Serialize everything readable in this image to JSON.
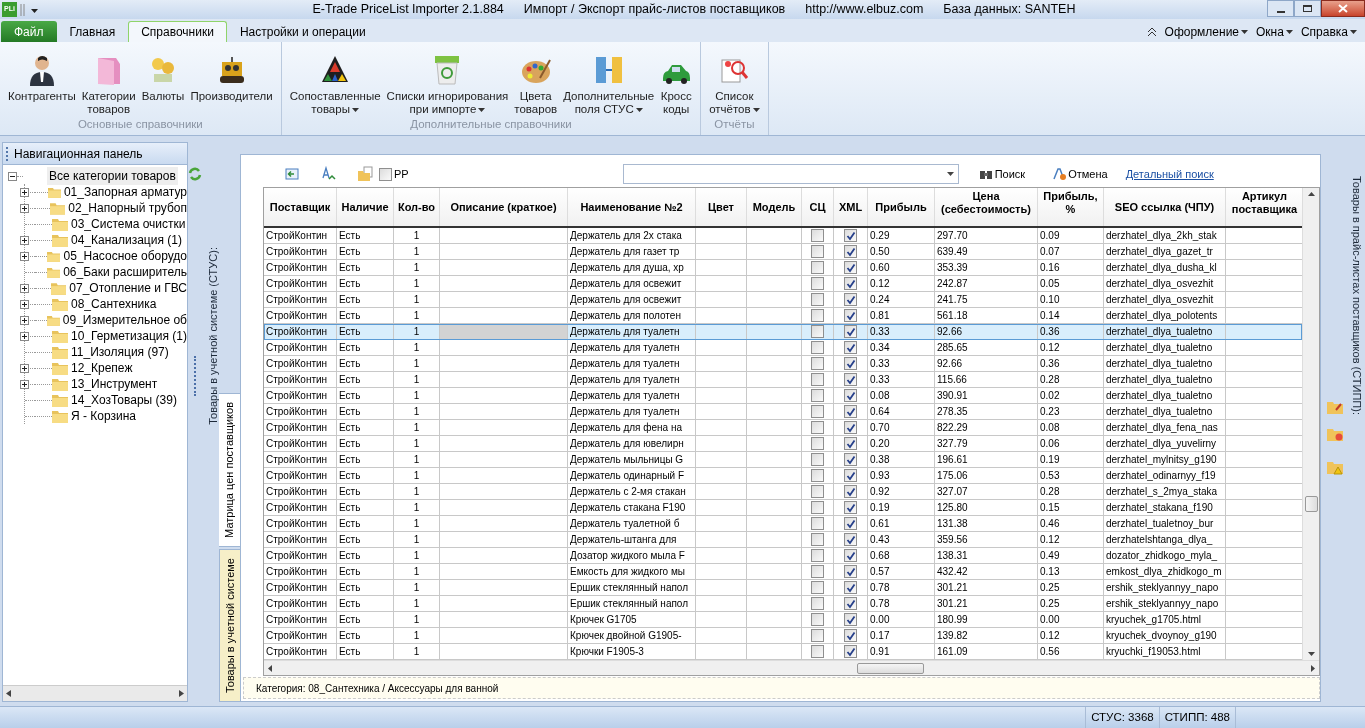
{
  "title_bar": {
    "logo": "PLi",
    "app": "E-Trade PriceList Importer 2.1.884",
    "subtitle": "Импорт / Экспорт прайс-листов поставщиков",
    "url": "http://www.elbuz.com",
    "database": "База данных: SANTEH"
  },
  "menu_tabs": [
    {
      "label": "Файл",
      "kind": "file",
      "selected": false
    },
    {
      "label": "Главная",
      "kind": "tab",
      "selected": false
    },
    {
      "label": "Справочники",
      "kind": "tab",
      "selected": true
    },
    {
      "label": "Настройки и операции",
      "kind": "tab",
      "selected": false
    }
  ],
  "menu_right": [
    "Оформление",
    "Окна",
    "Справка"
  ],
  "ribbon": {
    "groups": [
      {
        "title": "Основные справочники",
        "items": [
          {
            "lines": [
              "Контрагенты"
            ],
            "dropdown": false
          },
          {
            "lines": [
              "Категории",
              "товаров"
            ],
            "dropdown": false
          },
          {
            "lines": [
              "Валюты"
            ],
            "dropdown": false
          },
          {
            "lines": [
              "Производители"
            ],
            "dropdown": false
          }
        ]
      },
      {
        "title": "Дополнительные справочники",
        "items": [
          {
            "lines": [
              "Сопоставленные",
              "товары"
            ],
            "dropdown": true
          },
          {
            "lines": [
              "Списки игнорирования",
              "при импорте"
            ],
            "dropdown": true
          },
          {
            "lines": [
              "Цвета",
              "товаров"
            ],
            "dropdown": false
          },
          {
            "lines": [
              "Дополнительные",
              "поля СТУС"
            ],
            "dropdown": true
          },
          {
            "lines": [
              "Кросс",
              "коды"
            ],
            "dropdown": false
          }
        ]
      },
      {
        "title": "Отчёты",
        "items": [
          {
            "lines": [
              "Список",
              "отчётов"
            ],
            "dropdown": true
          }
        ]
      }
    ]
  },
  "nav_panel": {
    "title": "Навигационная панель",
    "tree": {
      "label": "Все категории товаров",
      "expanded": true,
      "children": [
        {
          "label": "01_Запорная арматур",
          "kind": "branch"
        },
        {
          "label": "02_Напорный трубоп",
          "kind": "branch"
        },
        {
          "label": "03_Система очистки",
          "kind": "leaf"
        },
        {
          "label": "04_Канализация (1)",
          "kind": "branch"
        },
        {
          "label": "05_Насосное оборудо",
          "kind": "branch"
        },
        {
          "label": "06_Баки расширитель",
          "kind": "leaf"
        },
        {
          "label": "07_Отопление и ГВС",
          "kind": "branch"
        },
        {
          "label": "08_Сантехника",
          "kind": "branch"
        },
        {
          "label": "09_Измерительное об",
          "kind": "branch"
        },
        {
          "label": "10_Герметизация (1)",
          "kind": "branch"
        },
        {
          "label": "11_Изоляция (97)",
          "kind": "leaf"
        },
        {
          "label": "12_Крепеж",
          "kind": "branch"
        },
        {
          "label": "13_Инструмент",
          "kind": "branch"
        },
        {
          "label": "14_ХозТовары (39)",
          "kind": "leaf"
        },
        {
          "label": "Я - Корзина",
          "kind": "leaf"
        }
      ]
    }
  },
  "side_label": "Товары в учетной системе (СТУС):",
  "side_tabs": [
    {
      "label": "Матрица цен поставщиков",
      "selected": true
    },
    {
      "label": "Товары в учетной системе",
      "selected": false
    }
  ],
  "toolbar": {
    "pp_checkbox": {
      "label": "PP",
      "checked": false
    },
    "search_button": "Поиск",
    "cancel_button": "Отмена",
    "detail_link": "Детальный поиск"
  },
  "table": {
    "columns": [
      {
        "label": "Поставщик",
        "kind": "text"
      },
      {
        "label": "Наличие",
        "kind": "text"
      },
      {
        "label": "Кол-во",
        "kind": "center"
      },
      {
        "label": "Описание (краткое)",
        "kind": "text"
      },
      {
        "label": "Наименование №2",
        "kind": "text"
      },
      {
        "label": "Цвет",
        "kind": "text"
      },
      {
        "label": "Модель",
        "kind": "text"
      },
      {
        "label": "СЦ",
        "kind": "check"
      },
      {
        "label": "XML",
        "kind": "check"
      },
      {
        "label": "Прибыль",
        "kind": "text"
      },
      {
        "label": "Цена\n(себестоимость)",
        "kind": "text"
      },
      {
        "label": "Прибыль,\n%",
        "kind": "text"
      },
      {
        "label": "SEO ссылка (ЧПУ)",
        "kind": "text"
      },
      {
        "label": "Артикул\nпоставщика",
        "kind": "text"
      }
    ],
    "rows": [
      {
        "selected": false,
        "cells": [
          "СтройКонтин",
          "Есть",
          "1",
          null,
          "Держатель для 2х стака",
          null,
          null,
          false,
          true,
          "0.29",
          "297.70",
          "0.09",
          "derzhatel_dlya_2kh_stak",
          null
        ]
      },
      {
        "selected": false,
        "cells": [
          "СтройКонтин",
          "Есть",
          "1",
          null,
          "Держатель для газет тр",
          null,
          null,
          false,
          true,
          "0.50",
          "639.49",
          "0.07",
          "derzhatel_dlya_gazet_tr",
          null
        ]
      },
      {
        "selected": false,
        "cells": [
          "СтройКонтин",
          "Есть",
          "1",
          null,
          "Держатель для душа, хр",
          null,
          null,
          false,
          true,
          "0.60",
          "353.39",
          "0.16",
          "derzhatel_dlya_dusha_kl",
          null
        ]
      },
      {
        "selected": false,
        "cells": [
          "СтройКонтин",
          "Есть",
          "1",
          null,
          "Держатель для освежит",
          null,
          null,
          false,
          true,
          "0.12",
          "242.87",
          "0.05",
          "derzhatel_dlya_osvezhit",
          null
        ]
      },
      {
        "selected": false,
        "cells": [
          "СтройКонтин",
          "Есть",
          "1",
          null,
          "Держатель для освежит",
          null,
          null,
          false,
          true,
          "0.24",
          "241.75",
          "0.10",
          "derzhatel_dlya_osvezhit",
          null
        ]
      },
      {
        "selected": false,
        "cells": [
          "СтройКонтин",
          "Есть",
          "1",
          null,
          "Держатель для полотен",
          null,
          null,
          false,
          true,
          "0.81",
          "561.18",
          "0.14",
          "derzhatel_dlya_polotents",
          null
        ]
      },
      {
        "selected": true,
        "cells": [
          "СтройКонтин",
          "Есть",
          "1",
          null,
          "Держатель для туалетн",
          null,
          null,
          false,
          true,
          "0.33",
          "92.66",
          "0.36",
          "derzhatel_dlya_tualetno",
          null
        ]
      },
      {
        "selected": false,
        "cells": [
          "СтройКонтин",
          "Есть",
          "1",
          null,
          "Держатель для туалетн",
          null,
          null,
          false,
          true,
          "0.34",
          "285.65",
          "0.12",
          "derzhatel_dlya_tualetno",
          null
        ]
      },
      {
        "selected": false,
        "cells": [
          "СтройКонтин",
          "Есть",
          "1",
          null,
          "Держатель для туалетн",
          null,
          null,
          false,
          true,
          "0.33",
          "92.66",
          "0.36",
          "derzhatel_dlya_tualetno",
          null
        ]
      },
      {
        "selected": false,
        "cells": [
          "СтройКонтин",
          "Есть",
          "1",
          null,
          "Держатель для туалетн",
          null,
          null,
          false,
          true,
          "0.33",
          "115.66",
          "0.28",
          "derzhatel_dlya_tualetno",
          null
        ]
      },
      {
        "selected": false,
        "cells": [
          "СтройКонтин",
          "Есть",
          "1",
          null,
          "Держатель для туалетн",
          null,
          null,
          false,
          true,
          "0.08",
          "390.91",
          "0.02",
          "derzhatel_dlya_tualetno",
          null
        ]
      },
      {
        "selected": false,
        "cells": [
          "СтройКонтин",
          "Есть",
          "1",
          null,
          "Держатель для туалетн",
          null,
          null,
          false,
          true,
          "0.64",
          "278.35",
          "0.23",
          "derzhatel_dlya_tualetno",
          null
        ]
      },
      {
        "selected": false,
        "cells": [
          "СтройКонтин",
          "Есть",
          "1",
          null,
          "Держатель для фена на",
          null,
          null,
          false,
          true,
          "0.70",
          "822.29",
          "0.08",
          "derzhatel_dlya_fena_nas",
          null
        ]
      },
      {
        "selected": false,
        "cells": [
          "СтройКонтин",
          "Есть",
          "1",
          null,
          "Держатель для ювелирн",
          null,
          null,
          false,
          true,
          "0.20",
          "327.79",
          "0.06",
          "derzhatel_dlya_yuvelirny",
          null
        ]
      },
      {
        "selected": false,
        "cells": [
          "СтройКонтин",
          "Есть",
          "1",
          null,
          "Держатель мыльницы G",
          null,
          null,
          false,
          true,
          "0.38",
          "196.61",
          "0.19",
          "derzhatel_mylnitsy_g190",
          null
        ]
      },
      {
        "selected": false,
        "cells": [
          "СтройКонтин",
          "Есть",
          "1",
          null,
          "Держатель одинарный F",
          null,
          null,
          false,
          true,
          "0.93",
          "175.06",
          "0.53",
          "derzhatel_odinarnyy_f19",
          null
        ]
      },
      {
        "selected": false,
        "cells": [
          "СтройКонтин",
          "Есть",
          "1",
          null,
          "Держатель с 2-мя стакан",
          null,
          null,
          false,
          true,
          "0.92",
          "327.07",
          "0.28",
          "derzhatel_s_2mya_staka",
          null
        ]
      },
      {
        "selected": false,
        "cells": [
          "СтройКонтин",
          "Есть",
          "1",
          null,
          "Держатель стакана F190",
          null,
          null,
          false,
          true,
          "0.19",
          "125.80",
          "0.15",
          "derzhatel_stakana_f190",
          null
        ]
      },
      {
        "selected": false,
        "cells": [
          "СтройКонтин",
          "Есть",
          "1",
          null,
          "Держатель туалетной б",
          null,
          null,
          false,
          true,
          "0.61",
          "131.38",
          "0.46",
          "derzhatel_tualetnoy_bur",
          null
        ]
      },
      {
        "selected": false,
        "cells": [
          "СтройКонтин",
          "Есть",
          "1",
          null,
          "Держатель-штанга для",
          null,
          null,
          false,
          true,
          "0.43",
          "359.56",
          "0.12",
          "derzhatelshtanga_dlya_",
          null
        ]
      },
      {
        "selected": false,
        "cells": [
          "СтройКонтин",
          "Есть",
          "1",
          null,
          "Дозатор жидкого мыла F",
          null,
          null,
          false,
          true,
          "0.68",
          "138.31",
          "0.49",
          "dozator_zhidkogo_myla_",
          null
        ]
      },
      {
        "selected": false,
        "cells": [
          "СтройКонтин",
          "Есть",
          "1",
          null,
          "Емкость для жидкого мы",
          null,
          null,
          false,
          true,
          "0.57",
          "432.42",
          "0.13",
          "emkost_dlya_zhidkogo_m",
          null
        ]
      },
      {
        "selected": false,
        "cells": [
          "СтройКонтин",
          "Есть",
          "1",
          null,
          "Ершик стеклянный напол",
          null,
          null,
          false,
          true,
          "0.78",
          "301.21",
          "0.25",
          "ershik_steklyannyy_napo",
          null
        ]
      },
      {
        "selected": false,
        "cells": [
          "СтройКонтин",
          "Есть",
          "1",
          null,
          "Ершик стеклянный напол",
          null,
          null,
          false,
          true,
          "0.78",
          "301.21",
          "0.25",
          "ershik_steklyannyy_napo",
          null
        ]
      },
      {
        "selected": false,
        "cells": [
          "СтройКонтин",
          "Есть",
          "1",
          null,
          "Крючек G1705",
          null,
          null,
          false,
          true,
          "0.00",
          "180.99",
          "0.00",
          "kryuchek_g1705.html",
          null
        ]
      },
      {
        "selected": false,
        "cells": [
          "СтройКонтин",
          "Есть",
          "1",
          null,
          "Крючек двойной G1905-",
          null,
          null,
          false,
          true,
          "0.17",
          "139.82",
          "0.12",
          "kryuchek_dvoynoy_g190",
          null
        ]
      },
      {
        "selected": false,
        "cells": [
          "СтройКонтин",
          "Есть",
          "1",
          null,
          "Крючки F1905-3",
          null,
          null,
          false,
          true,
          "0.91",
          "161.09",
          "0.56",
          "kryuchki_f19053.html",
          null
        ]
      }
    ]
  },
  "category_path": "Категория: 08_Сантехника / Аксессуары для ванной",
  "right_label": "Товары в прайс-листах поставщиков (СТИПП):",
  "status_bar": [
    "СТУС: 3368",
    "СТИПП: 488"
  ]
}
